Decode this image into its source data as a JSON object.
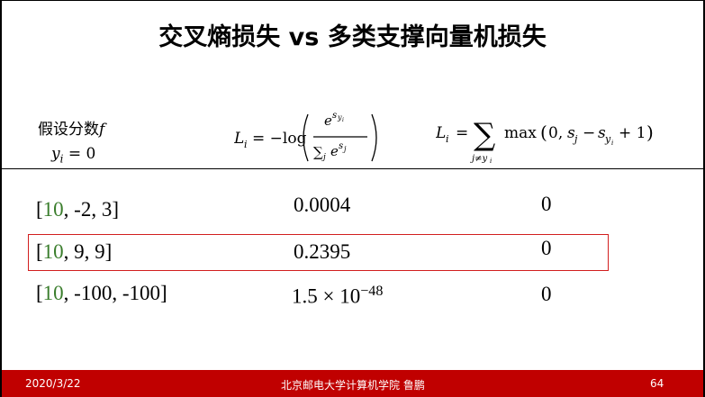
{
  "title": "交叉熵损失 vs 多类支撑向量机损失",
  "header": {
    "assume_label": "假设分数",
    "assume_var": "f",
    "y_i": "y",
    "y_i_sub": "i",
    "y_i_eq": "= 0"
  },
  "rows": [
    {
      "lead": "10",
      "rest": ", -2, 3]",
      "open": "[",
      "ce": "0.0004",
      "ce_exp": "",
      "svm": "0"
    },
    {
      "lead": "10",
      "rest": ", 9, 9]",
      "open": "[",
      "ce": "0.2395",
      "ce_exp": "",
      "svm": "0"
    },
    {
      "lead": "10",
      "rest": ", -100, -100]",
      "open": "[",
      "ce": "1.5 × 10",
      "ce_exp": "−48",
      "svm": "0"
    }
  ],
  "footer": {
    "date": "2020/3/22",
    "org": "北京邮电大学计算机学院  鲁鹏",
    "page": "64"
  },
  "colors": {
    "accent": "#c00000",
    "highlight": "#d21f1f",
    "lead_value": "#3a7d2c"
  }
}
